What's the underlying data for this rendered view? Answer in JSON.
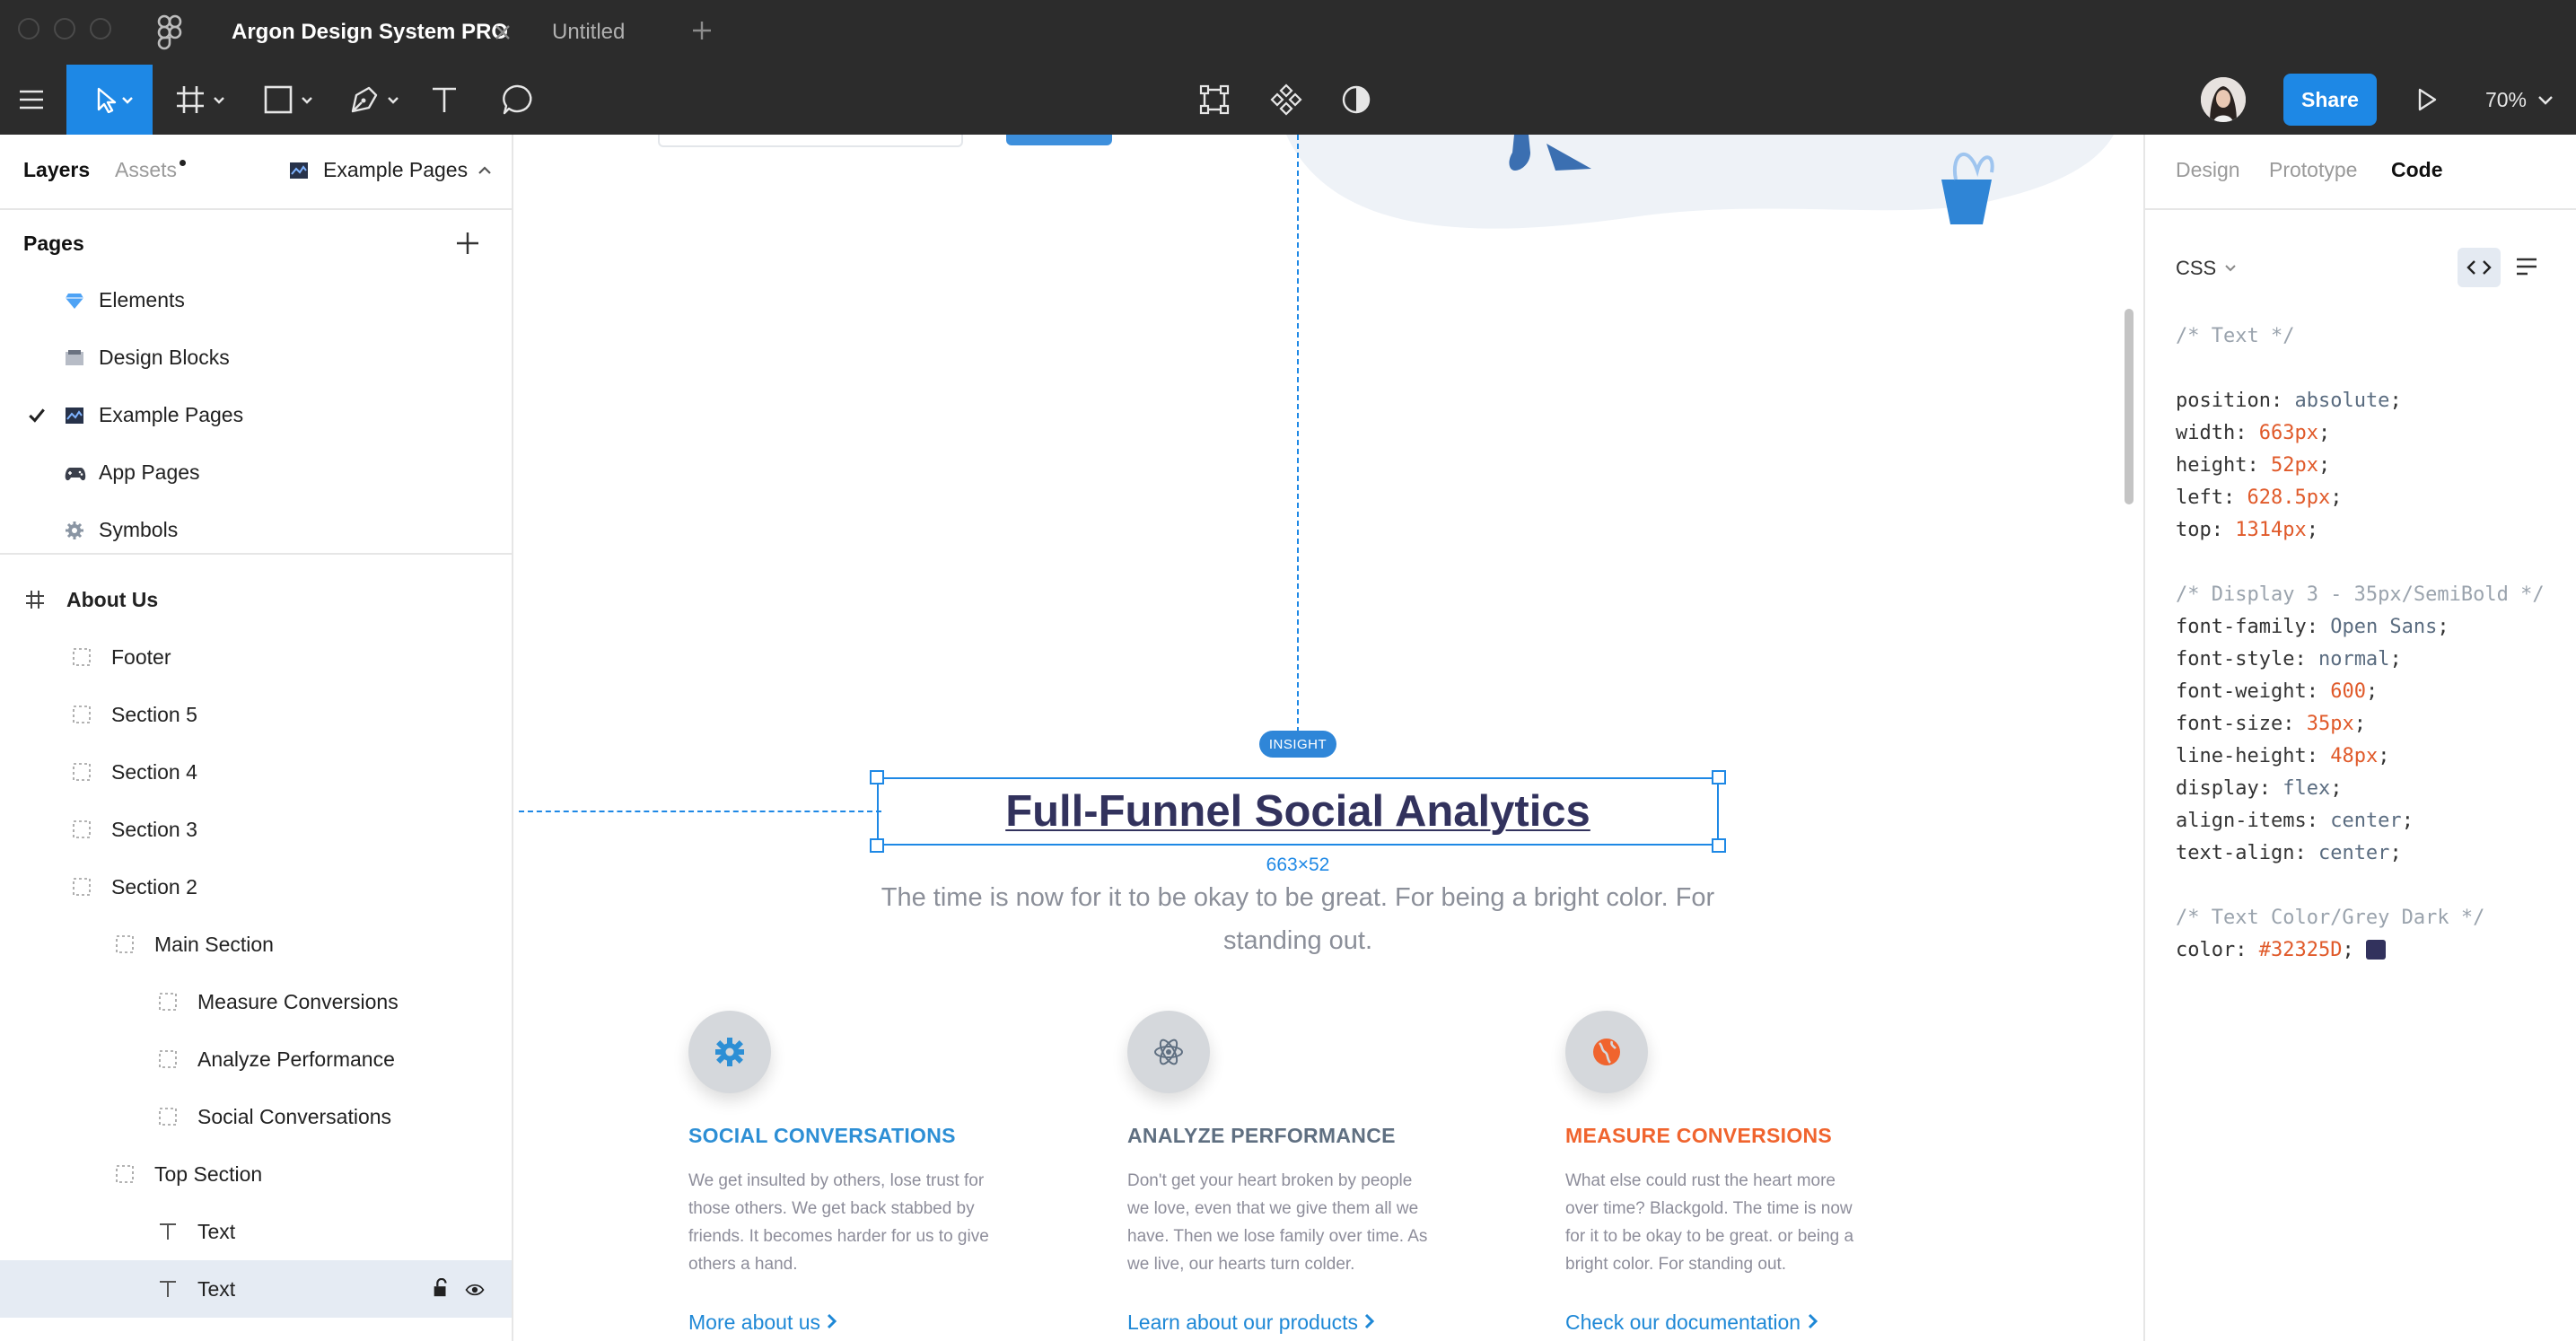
{
  "titlebar": {
    "tabs": [
      {
        "label": "Argon Design System PRO",
        "active": true
      },
      {
        "label": "Untitled",
        "active": false
      }
    ],
    "add_tab_icon": "plus-icon",
    "figma_icon": "figma-logo-icon"
  },
  "toolbar": {
    "share_label": "Share",
    "zoom_label": "70%",
    "tools": [
      "menu-icon",
      "move-icon",
      "frame-icon",
      "shape-icon",
      "pen-icon",
      "text-icon",
      "comment-icon"
    ],
    "center_tools": [
      "transform-icon",
      "component-icon",
      "contrast-icon"
    ],
    "accent": "#1e88e5"
  },
  "left_panel": {
    "tabs": {
      "layers": "Layers",
      "assets": "Assets"
    },
    "page_switcher": "Example Pages",
    "pages_title": "Pages",
    "pages": [
      {
        "label": "Elements",
        "icon": "diamond-icon",
        "checked": false
      },
      {
        "label": "Design Blocks",
        "icon": "blocks-icon",
        "checked": false
      },
      {
        "label": "Example Pages",
        "icon": "pages-icon",
        "checked": true
      },
      {
        "label": "App Pages",
        "icon": "gamepad-icon",
        "checked": false
      },
      {
        "label": "Symbols",
        "icon": "gear-icon",
        "checked": false
      }
    ],
    "frame_name": "About Us",
    "layers": [
      {
        "label": "Footer",
        "indent": 1,
        "type": "group"
      },
      {
        "label": "Section 5",
        "indent": 1,
        "type": "group"
      },
      {
        "label": "Section 4",
        "indent": 1,
        "type": "group"
      },
      {
        "label": "Section 3",
        "indent": 1,
        "type": "group"
      },
      {
        "label": "Section 2",
        "indent": 1,
        "type": "group"
      },
      {
        "label": "Main Section",
        "indent": 2,
        "type": "group"
      },
      {
        "label": "Measure Conversions",
        "indent": 3,
        "type": "group"
      },
      {
        "label": "Analyze Performance",
        "indent": 3,
        "type": "group"
      },
      {
        "label": "Social Conversations",
        "indent": 3,
        "type": "group"
      },
      {
        "label": "Top Section",
        "indent": 2,
        "type": "group"
      },
      {
        "label": "Text",
        "indent": 3,
        "type": "text"
      },
      {
        "label": "Text",
        "indent": 3,
        "type": "text",
        "selected": true
      }
    ]
  },
  "canvas": {
    "badge": "INSIGHT",
    "heading": "Full-Funnel Social Analytics",
    "dimensions": "663×52",
    "subtext_line1": "The time is now for it to be okay to be great. For being a bright color. For",
    "subtext_line2": "standing out.",
    "features": [
      {
        "title": "SOCIAL CONVERSATIONS",
        "color": "#2d8fd5",
        "icon": "gear-icon",
        "desc": [
          "We get insulted by others, lose trust for",
          "those others. We get back stabbed by",
          "friends. It becomes harder for us to give",
          "others a hand."
        ],
        "link": "More about us"
      },
      {
        "title": "ANALYZE PERFORMANCE",
        "color": "#5f6f81",
        "icon": "atom-icon",
        "desc": [
          "Don't get your heart broken by people",
          "we love, even that we give them all we",
          "have. Then we lose family over time. As",
          "we live, our hearts turn colder."
        ],
        "link": "Learn about our products"
      },
      {
        "title": "MEASURE CONVERSIONS",
        "color": "#f0642e",
        "icon": "globe-icon",
        "desc": [
          "What else could rust the heart more",
          "over time? Blackgold. The time is now",
          "for it to be okay to be great. or being a",
          "bright color. For standing out."
        ],
        "link": "Check our documentation"
      }
    ]
  },
  "right_panel": {
    "tabs": {
      "design": "Design",
      "prototype": "Prototype",
      "code": "Code"
    },
    "language": "CSS",
    "code_lines": [
      {
        "t": "c",
        "text": "/* Text */"
      },
      {
        "t": "blank"
      },
      {
        "t": "kv",
        "k": "position",
        "v": "absolute",
        "vt": "v"
      },
      {
        "t": "kv",
        "k": "width",
        "v": "663px",
        "vt": "n"
      },
      {
        "t": "kv",
        "k": "height",
        "v": "52px",
        "vt": "n"
      },
      {
        "t": "kv",
        "k": "left",
        "v": "628.5px",
        "vt": "n"
      },
      {
        "t": "kv",
        "k": "top",
        "v": "1314px",
        "vt": "n"
      },
      {
        "t": "blank"
      },
      {
        "t": "c",
        "text": "/* Display 3 - 35px/SemiBold */"
      },
      {
        "t": "kv",
        "k": "font-family",
        "v": "Open Sans",
        "vt": "v"
      },
      {
        "t": "kv",
        "k": "font-style",
        "v": "normal",
        "vt": "v"
      },
      {
        "t": "kv",
        "k": "font-weight",
        "v": "600",
        "vt": "n"
      },
      {
        "t": "kv",
        "k": "font-size",
        "v": "35px",
        "vt": "n"
      },
      {
        "t": "kv",
        "k": "line-height",
        "v": "48px",
        "vt": "n"
      },
      {
        "t": "kv",
        "k": "display",
        "v": "flex",
        "vt": "v"
      },
      {
        "t": "kv",
        "k": "align-items",
        "v": "center",
        "vt": "v"
      },
      {
        "t": "kv",
        "k": "text-align",
        "v": "center",
        "vt": "v"
      },
      {
        "t": "blank"
      },
      {
        "t": "c",
        "text": "/* Text Color/Grey Dark */"
      },
      {
        "t": "kv",
        "k": "color",
        "v": "#32325D",
        "vt": "n",
        "swatch": "#32325D"
      }
    ]
  }
}
